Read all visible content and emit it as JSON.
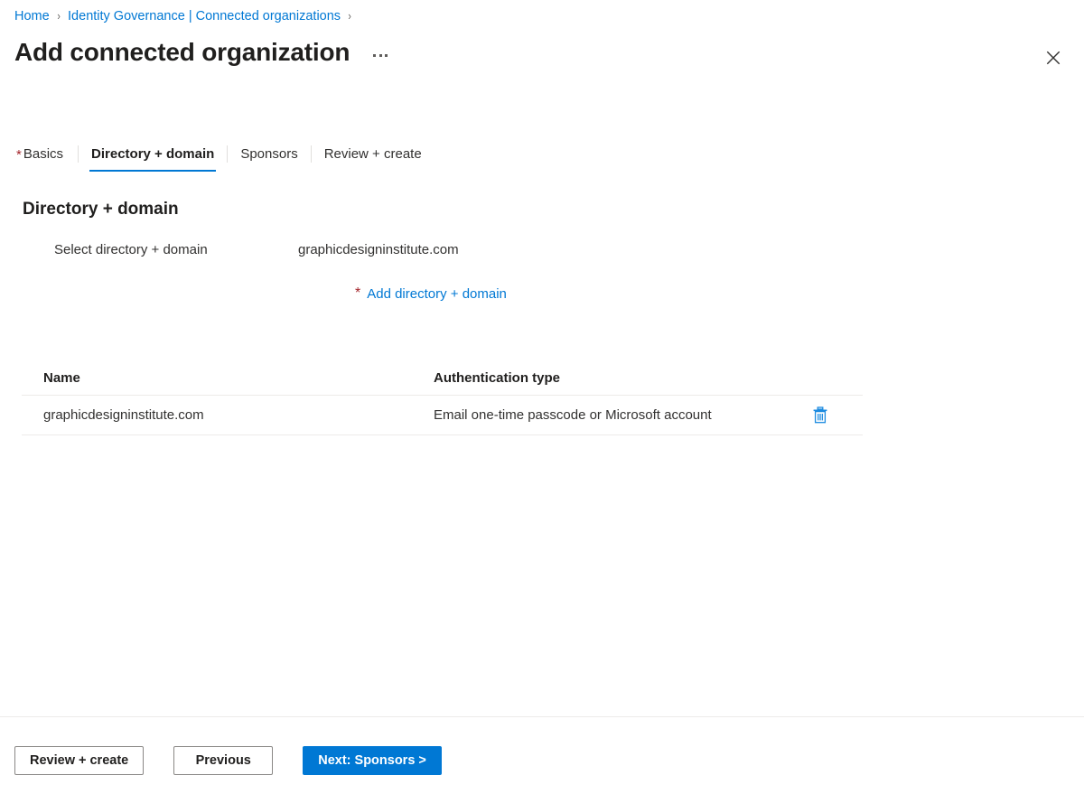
{
  "breadcrumb": {
    "items": [
      {
        "label": "Home",
        "icon": "none"
      },
      {
        "label": "Identity Governance | Connected organizations",
        "icon": "none"
      }
    ],
    "separator": "›"
  },
  "header": {
    "title": "Add connected organization",
    "more_actions_label": "···",
    "close_icon": "close-icon"
  },
  "tabs": [
    {
      "label": "Basics",
      "required": true,
      "active": false
    },
    {
      "label": "Directory + domain",
      "required": false,
      "active": true
    },
    {
      "label": "Sponsors",
      "required": false,
      "active": false
    },
    {
      "label": "Review + create",
      "required": false,
      "active": false
    }
  ],
  "section": {
    "heading": "Directory + domain",
    "field_label": "Select directory + domain",
    "field_value": "graphicdesigninstitute.com",
    "add_link": {
      "required_marker": "*",
      "label": "Add directory + domain"
    }
  },
  "table": {
    "columns": [
      "Name",
      "Authentication type",
      ""
    ],
    "rows": [
      {
        "name": "graphicdesigninstitute.com",
        "auth_type": "Email one-time passcode or Microsoft account",
        "action_icon": "delete-icon"
      }
    ]
  },
  "footer": {
    "review_create_label": "Review + create",
    "previous_label": "Previous",
    "next_label": "Next: Sponsors >"
  },
  "colors": {
    "accent": "#0078d4",
    "required": "#a4262c",
    "text": "#323130",
    "border": "#edebe9",
    "button_border": "#8a8886"
  }
}
